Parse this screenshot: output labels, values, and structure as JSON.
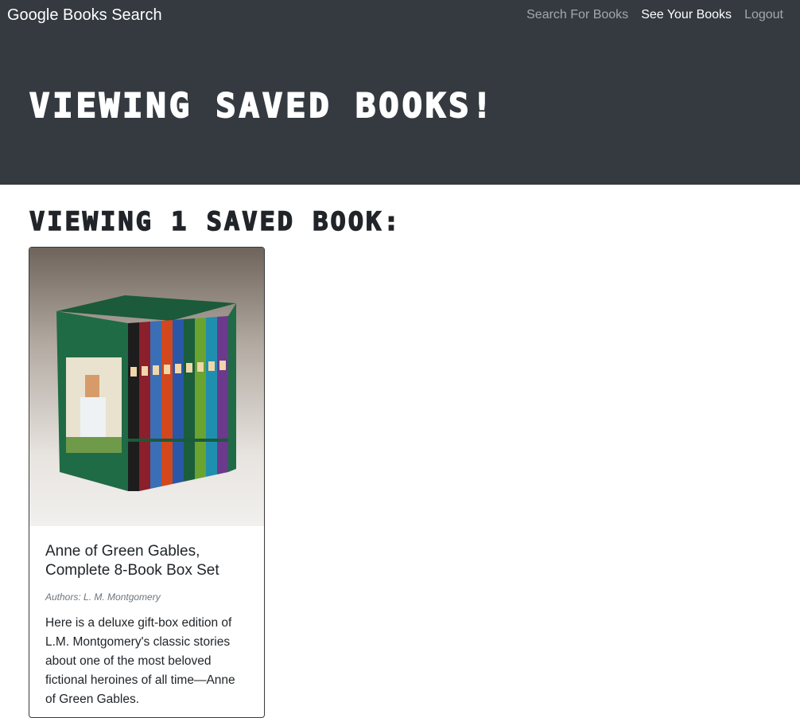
{
  "navbar": {
    "brand": "Google Books Search",
    "links": [
      {
        "label": "Search For Books",
        "active": false
      },
      {
        "label": "See Your Books",
        "active": true
      },
      {
        "label": "Logout",
        "active": false
      }
    ]
  },
  "hero": {
    "title": "Viewing saved books!"
  },
  "saved": {
    "heading": "Viewing 1 saved book:",
    "books": [
      {
        "title": "Anne of Green Gables, Complete 8-Book Box Set",
        "authors": "Authors: L. M. Montgomery",
        "description": "Here is a deluxe gift-box edition of L.M. Montgomery's classic stories about one of the most beloved fictional heroines of all time—Anne of Green Gables."
      }
    ]
  },
  "colors": {
    "navbar_bg": "#343a40",
    "box_green": "#1f6b45"
  }
}
